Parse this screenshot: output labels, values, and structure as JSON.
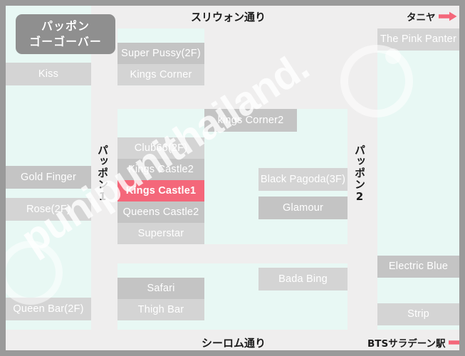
{
  "title": {
    "line1": "パッポン",
    "line2": "ゴーゴーバー"
  },
  "watermark": {
    "text": "punipunithailand."
  },
  "colors": {
    "highlight": "#f4677a",
    "lot": "#e8f8f4",
    "bar_a": "#c4c4c4",
    "bar_b": "#d4d4d4",
    "paper": "#efeeee",
    "frame": "#9a9a9a",
    "arrow": "#f4677a"
  },
  "streets": {
    "top": "スリウォン通り",
    "bottom": "シーロム通り",
    "left_vertical": "パッポン1",
    "right_vertical": "パッポン2"
  },
  "directions": {
    "top_right": "タニヤ",
    "bottom_right": "BTSサラデーン駅",
    "arrow_icon": "right-arrow-icon"
  },
  "bars": {
    "west_column": [
      {
        "name": "Kiss"
      },
      {
        "name": "Gold Finger"
      },
      {
        "name": "Rose(2F)"
      },
      {
        "name": "Queen Bar(2F)"
      }
    ],
    "patpong1_east_upper": [
      {
        "name": "Super Pussy(2F)"
      },
      {
        "name": "Kings Corner"
      }
    ],
    "patpong1_east_middle": [
      {
        "name": "Club66(2F)"
      },
      {
        "name": "Kings Castle2"
      },
      {
        "name": "Kings Castle1",
        "highlighted": true
      },
      {
        "name": "Queens Castle2"
      },
      {
        "name": "Superstar"
      }
    ],
    "patpong1_east_lower": [
      {
        "name": "Safari"
      },
      {
        "name": "Thigh Bar"
      }
    ],
    "inner_block": [
      {
        "name": "kings Corner2"
      },
      {
        "name": "Black Pagoda(3F)"
      },
      {
        "name": "Glamour"
      },
      {
        "name": "Bada Bing"
      }
    ],
    "patpong2_east": [
      {
        "name": "The Pink Panter"
      },
      {
        "name": "Electric Blue"
      },
      {
        "name": "Strip"
      }
    ]
  }
}
